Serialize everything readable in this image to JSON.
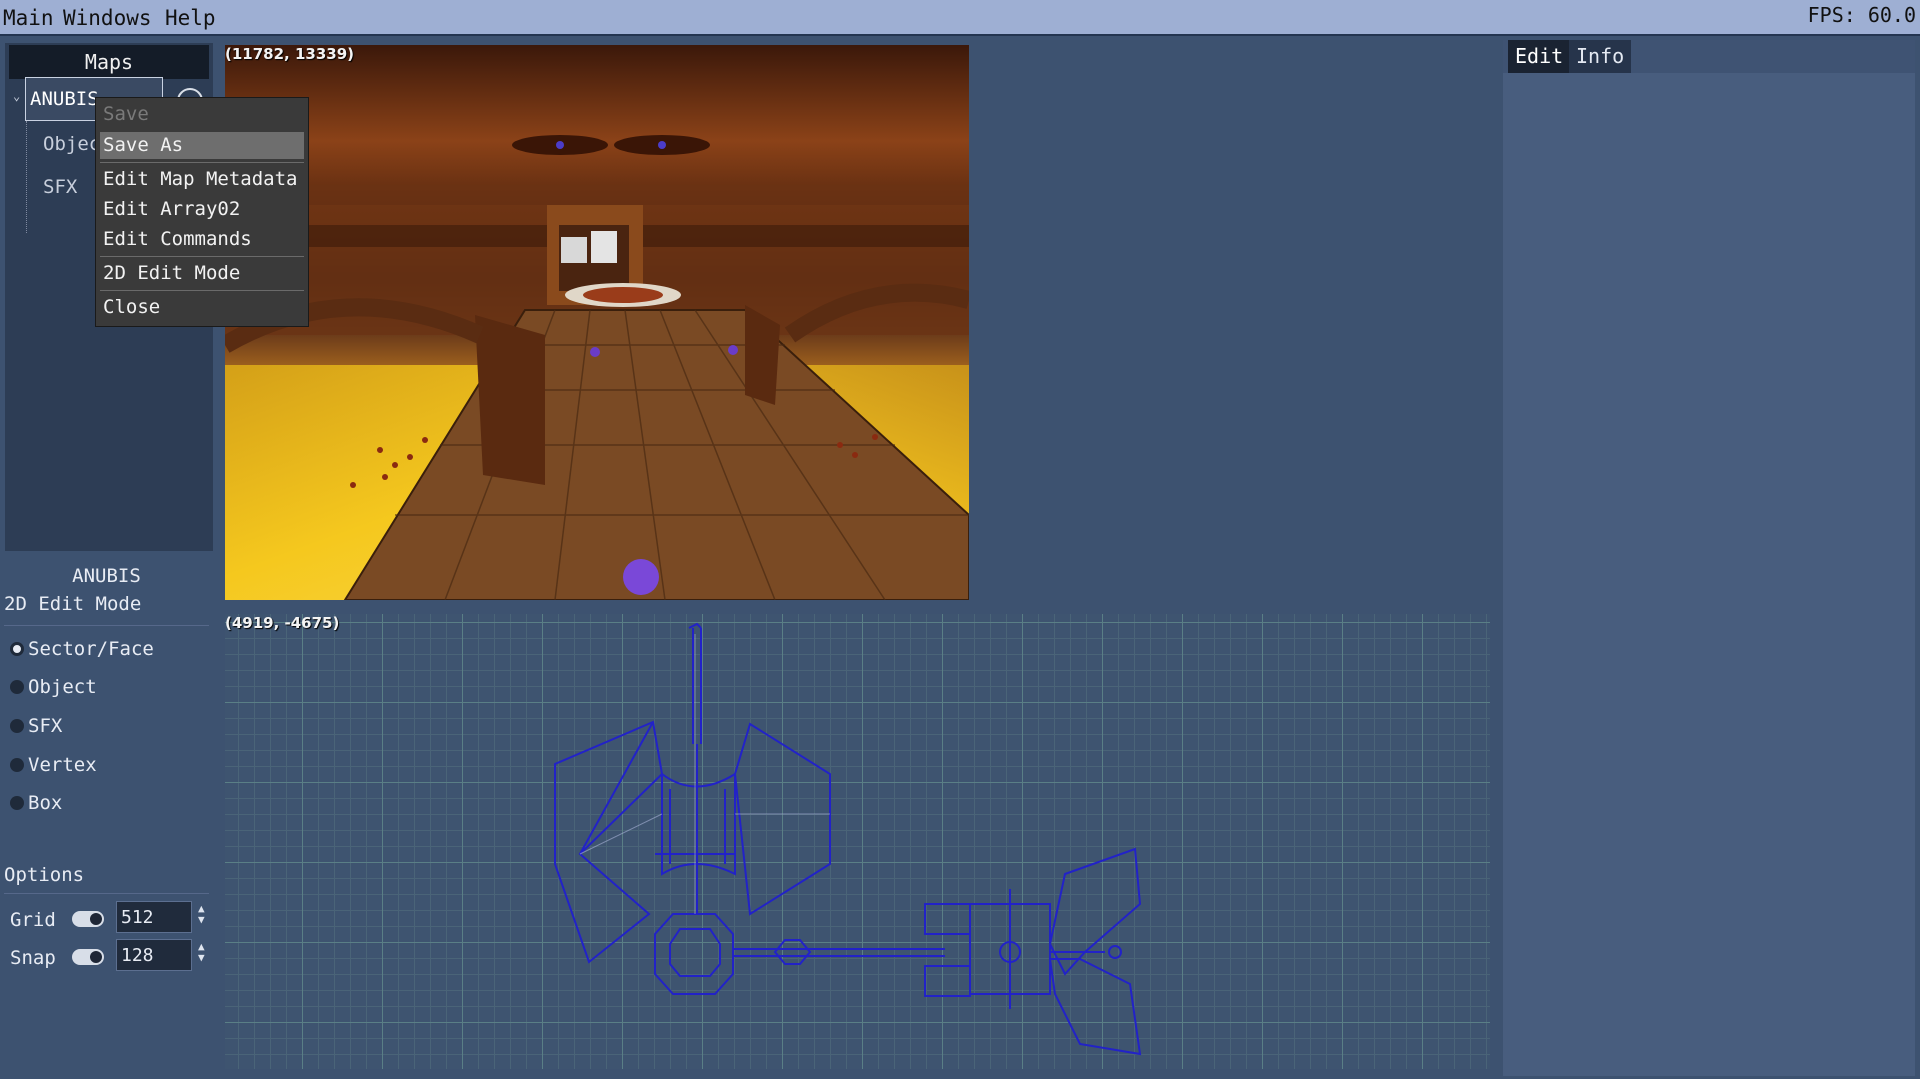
{
  "menubar": {
    "main": "Main",
    "windows": "Windows",
    "help": "Help",
    "fps": "FPS: 60.0"
  },
  "maps_panel": {
    "header": "Maps",
    "map_name": "ANUBIS",
    "children": [
      "Objects",
      "SFX"
    ]
  },
  "context_menu": {
    "items": [
      "Save",
      "Save As",
      "Edit Map Metadata",
      "Edit Array02",
      "Edit Commands",
      "2D Edit Mode",
      "Close"
    ]
  },
  "view3d": {
    "coords": "(11782, 13339)"
  },
  "view2d": {
    "coords": "(4919, -4675)"
  },
  "edit_panel": {
    "map_name": "ANUBIS",
    "mode": "2D Edit Mode",
    "radio": [
      "Sector/Face",
      "Object",
      "SFX",
      "Vertex",
      "Box"
    ],
    "selected": "Sector/Face",
    "options_label": "Options",
    "grid_label": "Grid",
    "grid_value": "512",
    "snap_label": "Snap",
    "snap_value": "128"
  },
  "right_panel": {
    "tabs": [
      "Edit",
      "Info"
    ],
    "active_tab": "Edit"
  },
  "colors": {
    "menubar": "#9eafd3",
    "panel": "#3d5270",
    "dark": "#2d3d55",
    "wireframe": "#2020c8"
  }
}
